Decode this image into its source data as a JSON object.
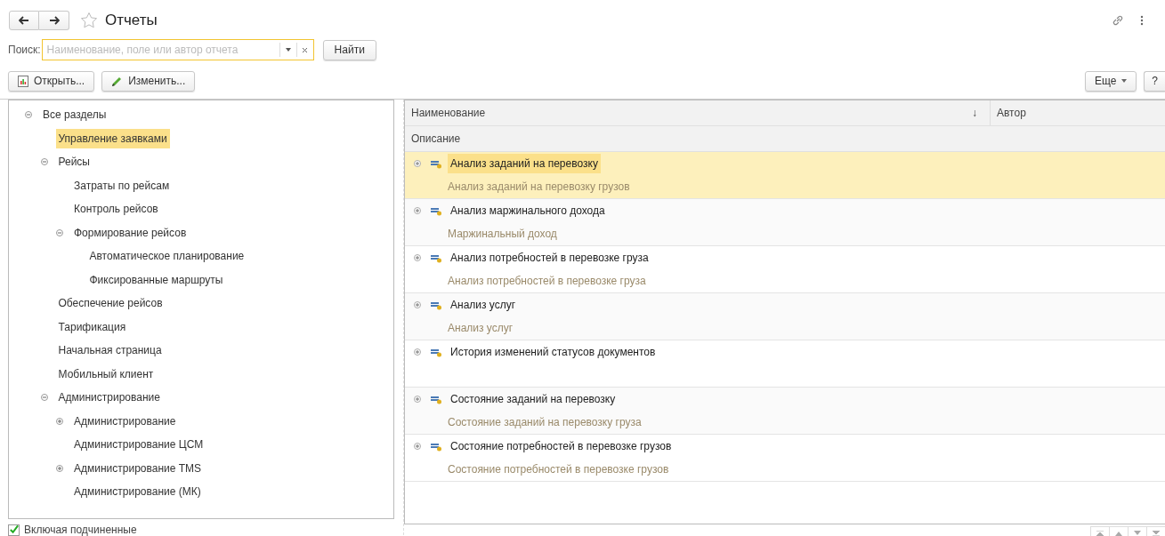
{
  "window": {
    "title": "Отчеты",
    "favorite": false
  },
  "search": {
    "label": "Поиск:",
    "placeholder": "Наименование, поле или автор отчета",
    "find_button": "Найти"
  },
  "toolbar": {
    "open_button": "Открыть...",
    "edit_button": "Изменить...",
    "more_button": "Еще",
    "help_button": "?"
  },
  "sections": [
    {
      "label": "Все разделы",
      "expanded": true,
      "selected": false,
      "children": [
        {
          "label": "Управление заявками",
          "selected": true
        },
        {
          "label": "Рейсы",
          "expanded": true,
          "selected": false,
          "children": [
            {
              "label": "Затраты по рейсам",
              "selected": false
            },
            {
              "label": "Контроль рейсов",
              "selected": false
            },
            {
              "label": "Формирование рейсов",
              "expanded": true,
              "selected": false,
              "children": [
                {
                  "label": "Автоматическое планирование",
                  "selected": false
                },
                {
                  "label": "Фиксированные маршруты",
                  "selected": false
                }
              ]
            }
          ]
        },
        {
          "label": "Обеспечение рейсов",
          "selected": false
        },
        {
          "label": "Тарификация",
          "selected": false
        },
        {
          "label": "Начальная страница",
          "selected": false
        },
        {
          "label": "Мобильный клиент",
          "selected": false
        },
        {
          "label": "Администрирование",
          "expanded": true,
          "selected": false,
          "children": [
            {
              "label": "Администрирование",
              "expanded": false,
              "selected": false
            },
            {
              "label": "Администрирование ЦСМ",
              "selected": false
            },
            {
              "label": "Администрирование TMS",
              "expanded": false,
              "selected": false
            },
            {
              "label": "Администрирование (МК)",
              "selected": false
            }
          ]
        }
      ]
    }
  ],
  "include_subordinate": {
    "label": "Включая подчиненные",
    "checked": true
  },
  "table": {
    "columns": [
      {
        "label": "Наименование",
        "sort": "↓"
      },
      {
        "label": "Автор"
      }
    ],
    "subheader": "Описание",
    "rows": [
      {
        "name": "Анализ заданий на перевозку",
        "description": "Анализ заданий на перевозку грузов",
        "selected": true,
        "expanded": false
      },
      {
        "name": "Анализ маржинального дохода",
        "description": "Маржинальный доход",
        "selected": false,
        "expanded": false
      },
      {
        "name": "Анализ потребностей в перевозке груза",
        "description": "Анализ потребностей в перевозке груза",
        "selected": false,
        "expanded": false
      },
      {
        "name": "Анализ услуг",
        "description": "Анализ услуг",
        "selected": false,
        "expanded": false
      },
      {
        "name": "История изменений статусов документов",
        "selected": false,
        "expanded": false
      },
      {
        "name": "Состояние заданий на перевозку",
        "description": "Состояние заданий на перевозку груза",
        "selected": false,
        "expanded": false
      },
      {
        "name": "Состояние потребностей в перевозке грузов",
        "description": "Состояние потребностей в перевозке грузов",
        "selected": false,
        "expanded": false
      }
    ]
  }
}
